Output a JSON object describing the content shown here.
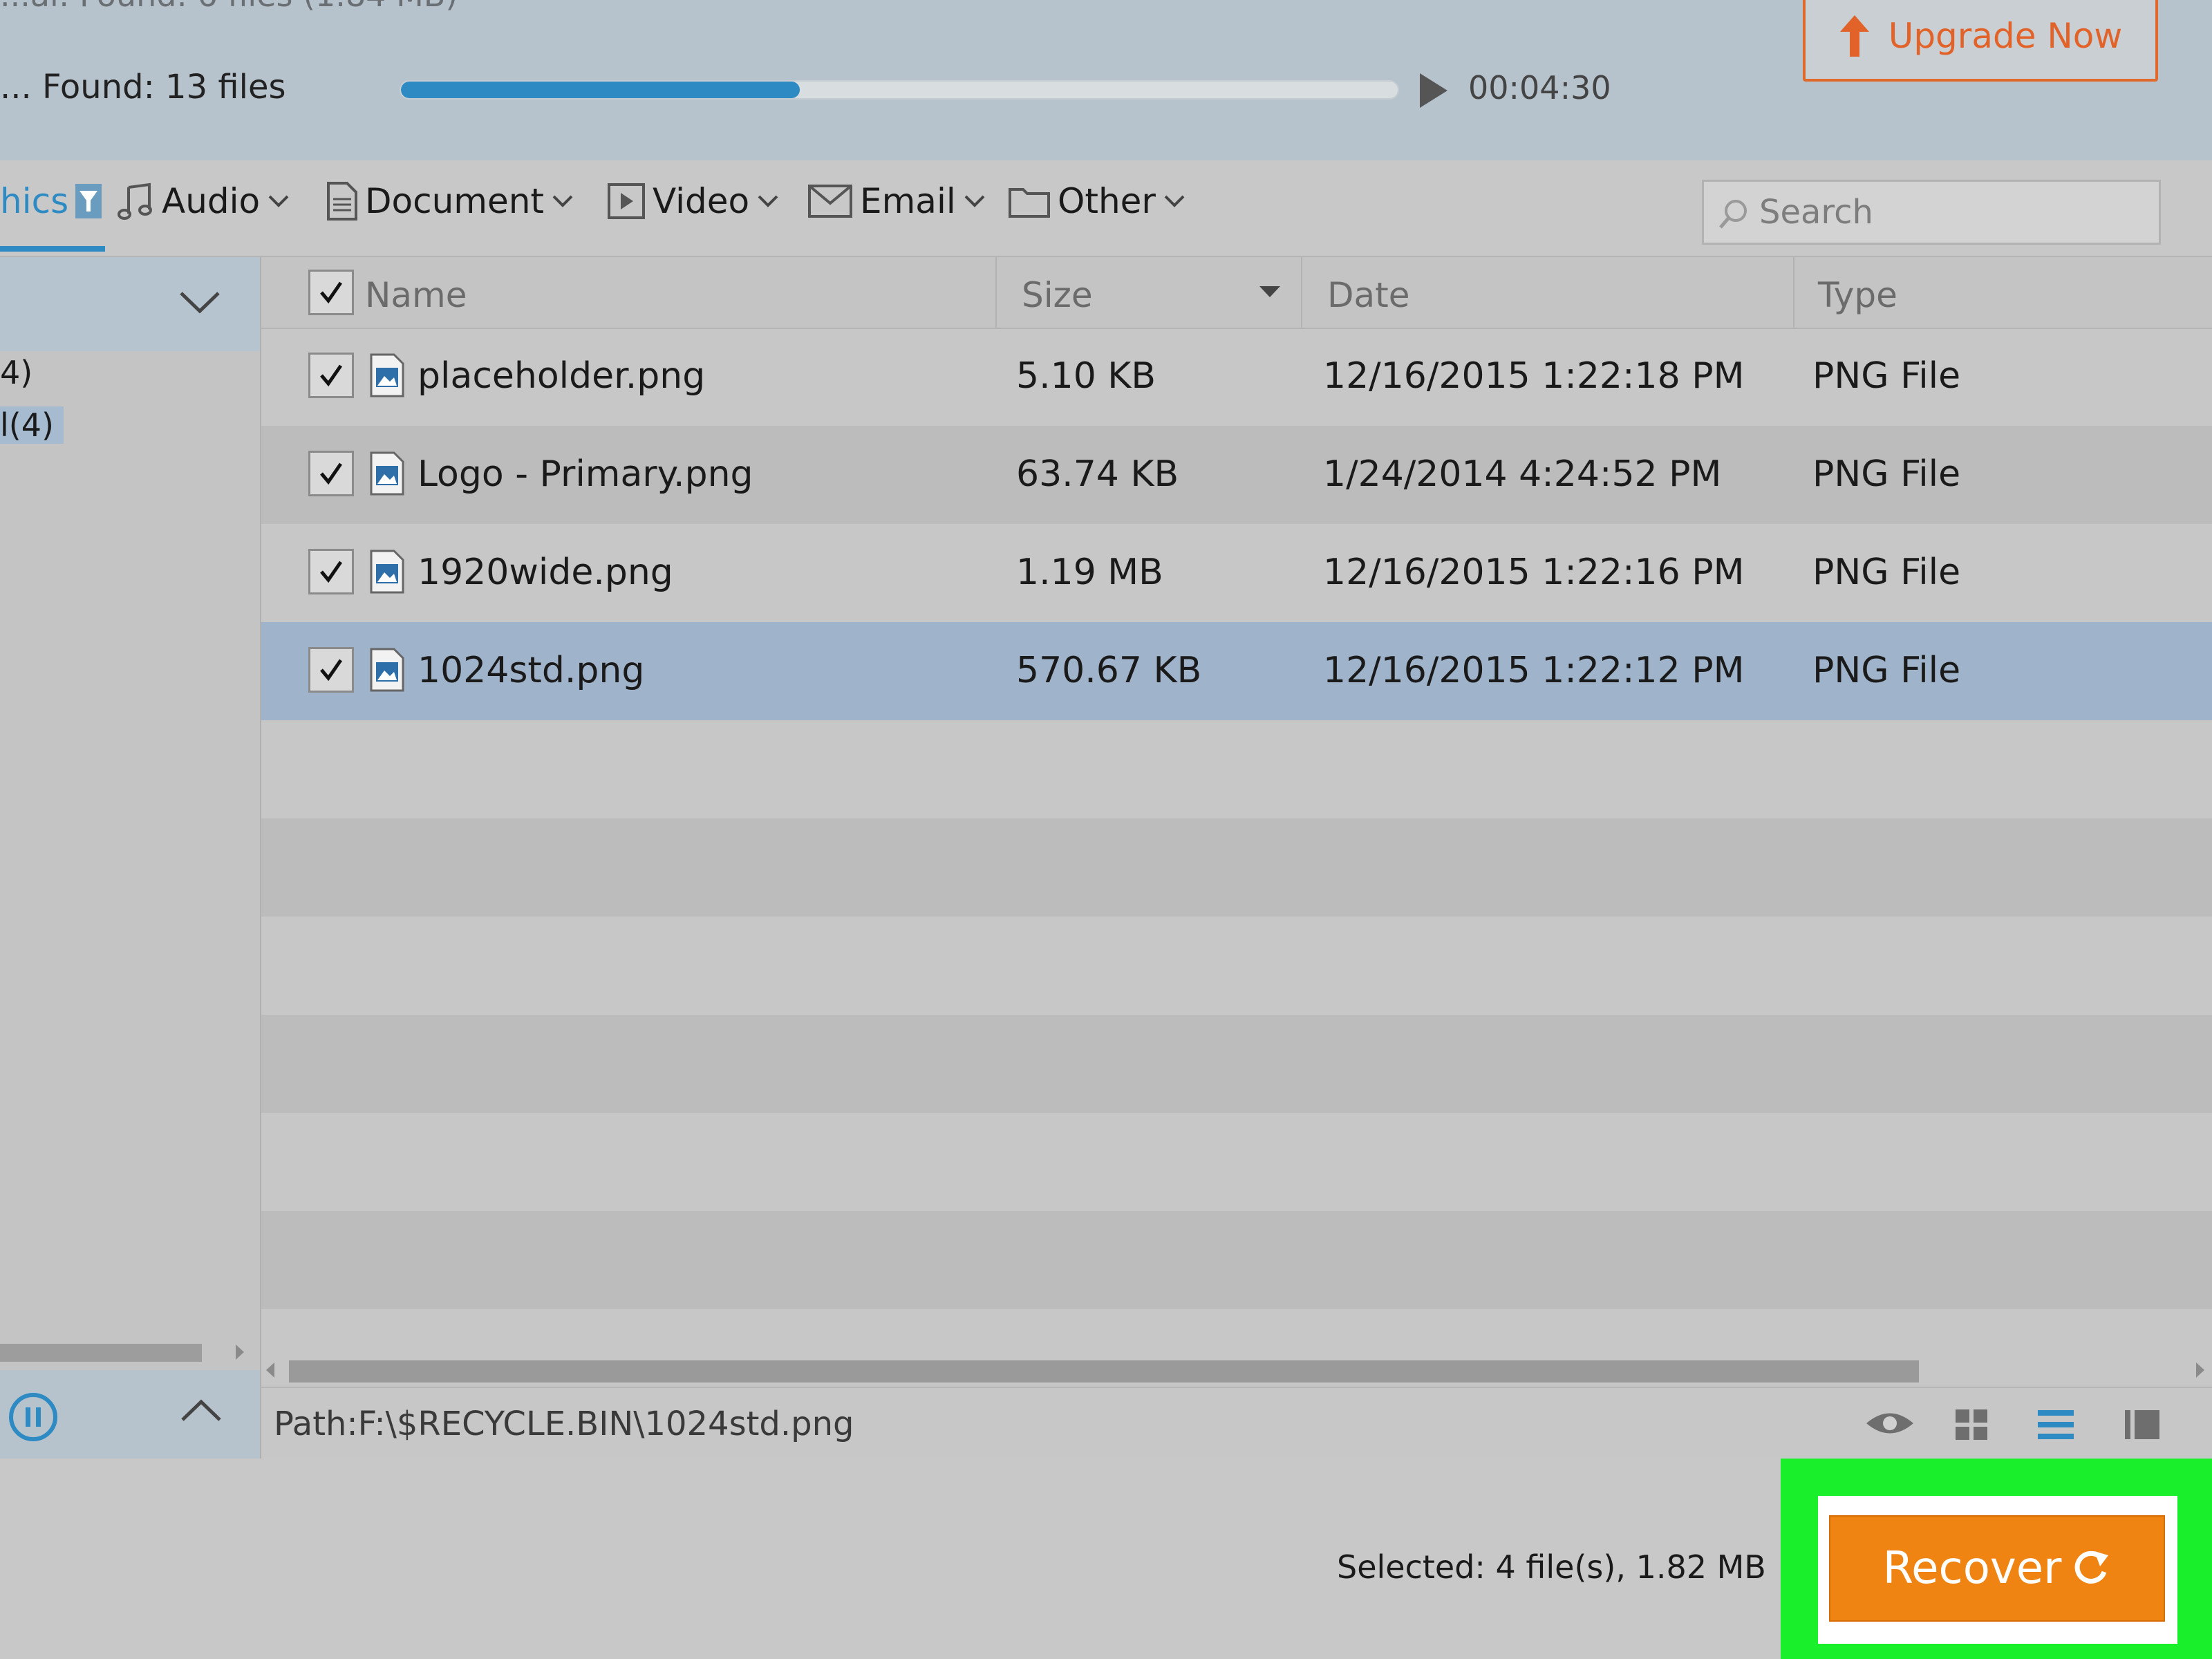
{
  "header": {
    "status_top": "...al: Found: 6 files (1.84 MB)",
    "status_found": "... Found: 13 files",
    "progress": 0.4,
    "elapsed": "00:04:30",
    "upgrade_label": "Upgrade Now"
  },
  "filters": {
    "items": [
      {
        "label": "hics",
        "icon": "filter-icon"
      },
      {
        "label": "Audio",
        "icon": "music-note-icon"
      },
      {
        "label": "Document",
        "icon": "document-icon"
      },
      {
        "label": "Video",
        "icon": "video-icon"
      },
      {
        "label": "Email",
        "icon": "envelope-icon"
      },
      {
        "label": "Other",
        "icon": "folder-icon"
      }
    ],
    "search_placeholder": "Search"
  },
  "tree": {
    "items": [
      "4)",
      "l(4)"
    ]
  },
  "table": {
    "columns": [
      "Name",
      "Size",
      "Date",
      "Type"
    ],
    "rows": [
      {
        "name": "placeholder.png",
        "size": "5.10 KB",
        "date": "12/16/2015 1:22:18 PM",
        "type": "PNG File"
      },
      {
        "name": "Logo - Primary.png",
        "size": "63.74 KB",
        "date": "1/24/2014 4:24:52 PM",
        "type": "PNG File"
      },
      {
        "name": "1920wide.png",
        "size": "1.19 MB",
        "date": "12/16/2015 1:22:16 PM",
        "type": "PNG File"
      },
      {
        "name": "1024std.png",
        "size": "570.67 KB",
        "date": "12/16/2015 1:22:12 PM",
        "type": "PNG File"
      }
    ]
  },
  "path_bar": {
    "path": "Path:F:\\$RECYCLE.BIN\\1024std.png"
  },
  "footer": {
    "selected": "Selected: 4 file(s), 1.82 MB",
    "recover_label": "Recover"
  },
  "colors": {
    "accent": "#2d8ac3",
    "recover": "#f08413",
    "upgrade": "#e2632a",
    "highlight": "#19f02b",
    "selected_row": "#9fb3ca"
  }
}
